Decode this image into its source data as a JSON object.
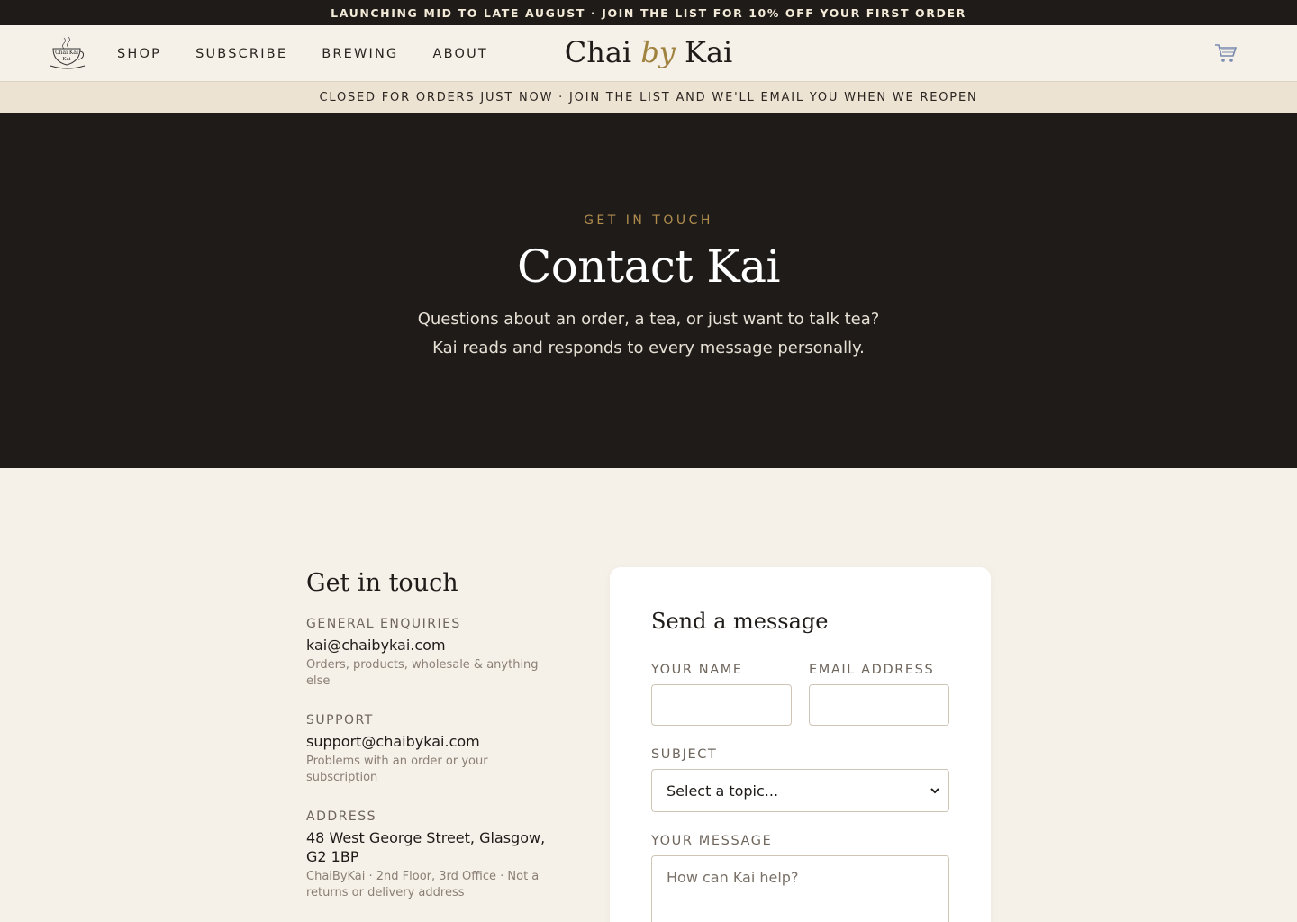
{
  "announcement": "LAUNCHING MID TO LATE AUGUST · JOIN THE LIST FOR 10% OFF YOUR FIRST ORDER",
  "header": {
    "logo_text": "Chai Kai",
    "nav": [
      {
        "label": "SHOP"
      },
      {
        "label": "SUBSCRIBE"
      },
      {
        "label": "BREWING"
      },
      {
        "label": "ABOUT"
      }
    ],
    "brand": {
      "part1": "Chai",
      "by": "by",
      "part2": "Kai"
    }
  },
  "notice": "CLOSED FOR ORDERS JUST NOW · JOIN THE LIST AND WE'LL EMAIL YOU WHEN WE REOPEN",
  "hero": {
    "eyebrow": "GET IN TOUCH",
    "title": "Contact Kai",
    "description": "Questions about an order, a tea, or just want to talk tea? Kai reads and responds to every message personally."
  },
  "contact": {
    "heading": "Get in touch",
    "blocks": [
      {
        "label": "GENERAL ENQUIRIES",
        "value": "kai@chaibykai.com",
        "note": "Orders, products, wholesale & anything else"
      },
      {
        "label": "SUPPORT",
        "value": "support@chaibykai.com",
        "note": "Problems with an order or your subscription"
      },
      {
        "label": "ADDRESS",
        "value": "48 West George Street, Glasgow, G2 1BP",
        "note": "ChaiByKai · 2nd Floor, 3rd Office · Not a returns or delivery address"
      }
    ]
  },
  "form": {
    "heading": "Send a message",
    "name_label": "YOUR NAME",
    "email_label": "EMAIL ADDRESS",
    "subject_label": "SUBJECT",
    "subject_selected": "Select a topic...",
    "message_label": "YOUR MESSAGE",
    "message_placeholder": "How can Kai help?"
  },
  "colors": {
    "dark": "#1f1b18",
    "cream": "#f5f0e8",
    "gold": "#b08d4f",
    "notice_bg": "#ece3d3"
  }
}
